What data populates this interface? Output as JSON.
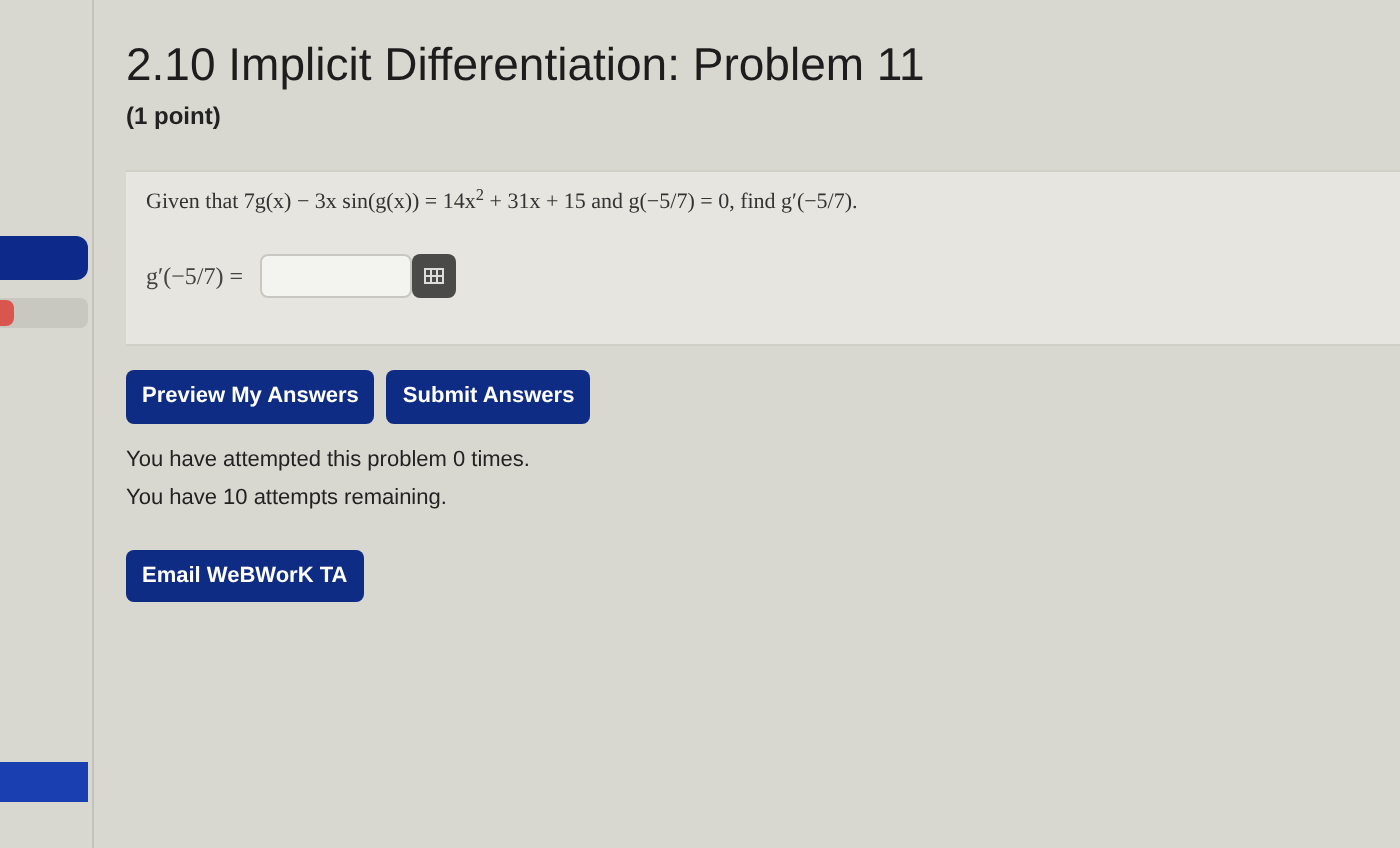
{
  "title": "2.10 Implicit Differentiation: Problem 11",
  "points": "(1 point)",
  "problem": {
    "statement": "Given that 7g(x) − 3x sin(g(x)) = 14x$^{2}$ + 31x + 15 and g(−5/7) = 0, find g′(−5/7).",
    "answer_label": "g′(−5/7) ="
  },
  "buttons": [
    "Preview My Answers",
    "Submit Answers"
  ],
  "messages": [
    "You have attempted this problem 0 times.",
    "You have 10 attempts remaining."
  ],
  "email_button": "Email WeBWorK TA"
}
